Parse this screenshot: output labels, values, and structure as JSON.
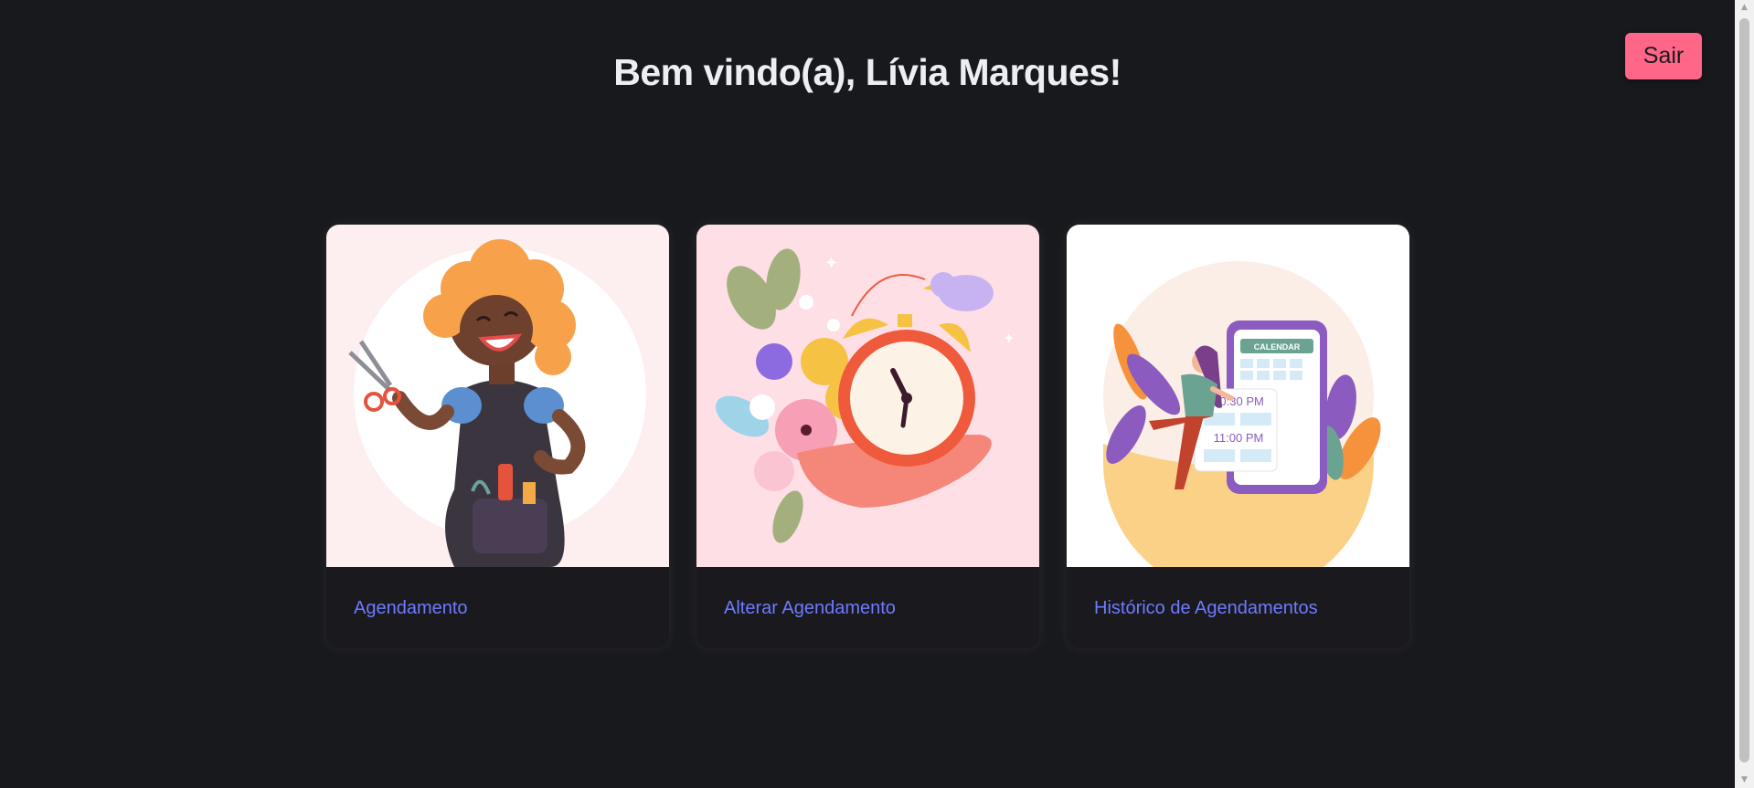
{
  "header": {
    "title": "Bem vindo(a), Lívia Marques!",
    "logout_label": "Sair"
  },
  "cards": [
    {
      "label": "Agendamento",
      "illustration": "hairdresser-illustration",
      "bg": "#fdeef0"
    },
    {
      "label": "Alterar Agendamento",
      "illustration": "alarm-clock-flowers-illustration",
      "bg": "#ffdfe6"
    },
    {
      "label": "Histórico de Agendamentos",
      "illustration": "calendar-phone-illustration",
      "bg": "#ffffff"
    }
  ],
  "calendar": {
    "header": "CALENDAR",
    "time1": "10:30 PM",
    "time2": "11:00 PM"
  },
  "colors": {
    "background": "#18191d",
    "accent": "#ff6688",
    "link": "#6e7bff"
  }
}
